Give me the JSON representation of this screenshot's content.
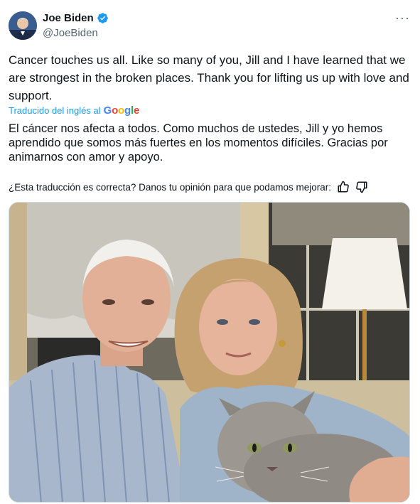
{
  "author": {
    "name": "Joe Biden",
    "handle": "@JoeBiden"
  },
  "tweet": {
    "text": "Cancer touches us all. Like so many of you, Jill and I have learned that we are strongest in the broken places. Thank you for lifting us up with love and support.",
    "translated_by_label": "Traducido del inglés al",
    "translation_provider": "Google",
    "translation": "El cáncer nos afecta a todos. Como muchos de ustedes, Jill y yo hemos aprendido que somos más fuertes en los momentos difíciles. Gracias por animarnos con amor y apoyo.",
    "feedback_prompt": "¿Esta traducción es correcta? Danos tu opinión para que podamos mejorar:"
  },
  "icons": {
    "verified": "verified-badge-icon",
    "more": "more-icon",
    "thumbs_up": "thumbs-up-icon",
    "thumbs_down": "thumbs-down-icon"
  },
  "colors": {
    "link": "#1d9bf0",
    "text": "#0f1419",
    "secondary": "#536471"
  }
}
